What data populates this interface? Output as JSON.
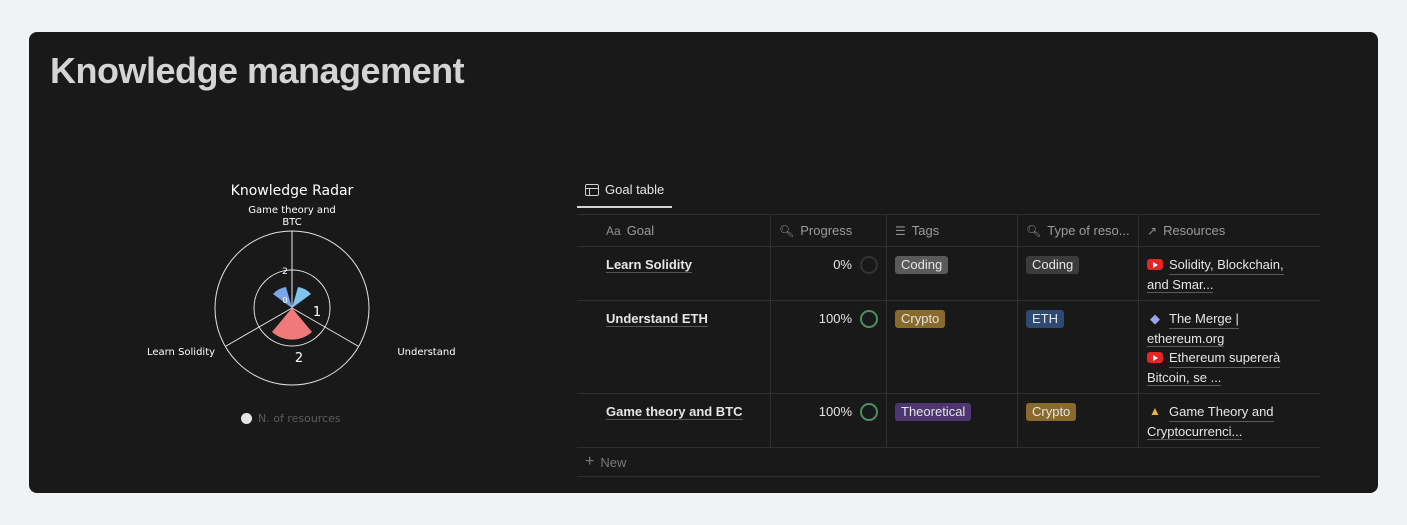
{
  "page": {
    "title": "Knowledge management"
  },
  "chart_data": {
    "type": "radar",
    "title": "Knowledge Radar",
    "categories": [
      "Game theory and BTC",
      "Understand ETH",
      "Learn Solidity"
    ],
    "category_label_lines": {
      "top": [
        "Game theory and",
        "BTC"
      ],
      "right": [
        "Understand ETH"
      ],
      "left": [
        "Learn Solidity"
      ]
    },
    "series": [
      {
        "name": "N. of resources",
        "values": [
          1,
          2,
          1
        ]
      }
    ],
    "scale_ticks": [
      "0",
      "2"
    ],
    "data_labels": [
      "1",
      "2"
    ],
    "colors": {
      "segment_a": "#7aa6e8",
      "segment_b": "#80c4ee",
      "segment_main": "#ef7a7a",
      "grid": "#e6e6e6"
    },
    "legend": {
      "label": "N. of resources",
      "position": "bottom"
    }
  },
  "view_tabs": [
    {
      "label": "Goal table",
      "icon": "table-icon"
    }
  ],
  "table": {
    "columns": [
      {
        "label": "Goal",
        "icon_text": "Aa"
      },
      {
        "label": "Progress",
        "icon": "search-icon"
      },
      {
        "label": "Tags",
        "icon": "list-icon"
      },
      {
        "label": "Type of reso...",
        "icon": "search-icon"
      },
      {
        "label": "Resources",
        "icon": "arrow-up-right-icon"
      }
    ],
    "rows": [
      {
        "goal": "Learn Solidity",
        "progress": "0%",
        "progress_complete": false,
        "tag": {
          "label": "Coding",
          "color": "#5a5a5a"
        },
        "type": {
          "label": "Coding",
          "color": "#3b3b3b"
        },
        "resources": [
          {
            "icon": "youtube-icon",
            "lines": [
              "Solidity, Blockchain,",
              "and Smar..."
            ]
          }
        ]
      },
      {
        "goal": "Understand ETH",
        "progress": "100%",
        "progress_complete": true,
        "tag": {
          "label": "Crypto",
          "color": "#8a6a2c"
        },
        "type": {
          "label": "ETH",
          "color": "#2e4a72"
        },
        "resources": [
          {
            "icon": "ethereum-icon",
            "lines": [
              "The Merge |",
              "ethereum.org"
            ]
          },
          {
            "icon": "youtube-icon",
            "lines": [
              "Ethereum supererà",
              "Bitcoin, se ..."
            ]
          }
        ]
      },
      {
        "goal": "Game theory and BTC",
        "progress": "100%",
        "progress_complete": true,
        "tag": {
          "label": "Theoretical",
          "color": "#4d3570"
        },
        "type": {
          "label": "Crypto",
          "color": "#8a6a2c"
        },
        "resources": [
          {
            "icon": "graduation-cap-icon",
            "lines": [
              "Game Theory and",
              "Cryptocurrenci..."
            ]
          }
        ]
      }
    ],
    "new_label": "New"
  }
}
